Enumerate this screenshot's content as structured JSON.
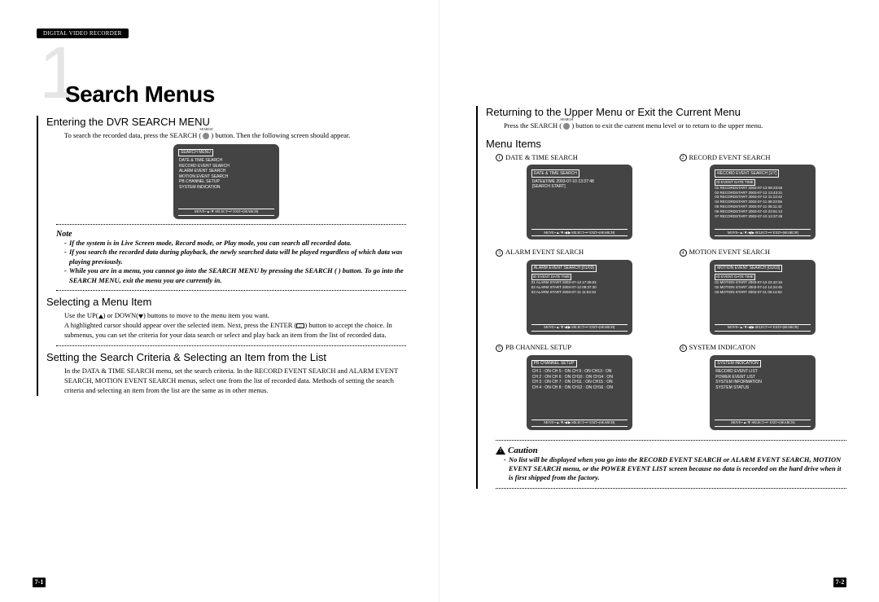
{
  "header_pill": "DIGITAL VIDEO RECORDER",
  "chapter_number": "1",
  "chapter_title": "Search Menus",
  "left": {
    "s1_title": "Entering the DVR SEARCH MENU",
    "s1_body_a": "To search the recorded data, press the SEARCH (",
    "s1_body_b": ") button. Then the following screen should appear.",
    "monitor1": {
      "title": "SEARCH MENU",
      "items": [
        "DATE & TIME SEARCH",
        "RECORD EVENT SEARCH",
        "ALARM EVENT SEARCH",
        "MOTION EVENT SEARCH",
        "PB CHANNEL SETUP",
        "SYSTEM INDICATION"
      ],
      "footer": "MOVE=▲/▼ SELECT=↵ EXIT=[SEARCH]"
    },
    "note_label": "Note",
    "note_items": [
      "If the system is in Live Screen mode, Record mode, or Play mode, you can search all recorded data.",
      "If you search the recorded data during playback, the newly searched data will be played regardless of which data was playing previously.",
      "While you are in a menu, you cannot go into the SEARCH MENU by pressing the SEARCH (      ) button. To go into the SEARCH MENU, exit the menu you are currently in."
    ],
    "s2_title": "Selecting a Menu Item",
    "s2_body_a": "Use the UP(",
    "s2_body_b": ") or DOWN(",
    "s2_body_c": ") buttons to move to the menu item you want.",
    "s2_body_d": "A highlighted cursor should appear over the selected item. Next, press the ENTER (",
    "s2_body_e": ") button to accept the choice. In submenus, you can set the criteria for your data search or select and play back an item from the list of recorded data.",
    "s3_title": "Setting the Search Criteria & Selecting an Item from the List",
    "s3_body": "In the DATA & TIME SEARCH menu, set the search criteria. In the RECORD EVENT SEARCH and ALARM EVENT SEARCH, MOTION EVENT SEARCH menus, select one from the list of recorded data. Methods of setting the search criteria and selecting an item from the list are the same as in other menus.",
    "page_num": "7-1"
  },
  "right": {
    "s1_title": "Returning to the Upper Menu or Exit the Current Menu",
    "s1_body_a": "Press the SEARCH (",
    "s1_body_b": ") button to exit the current menu level or to return to the upper menu.",
    "s2_title": "Menu Items",
    "labels": [
      "DATE & TIME SEARCH",
      "RECORD EVENT SEARCH",
      "ALARM EVENT SEARCH",
      "MOTION EVENT SEARCH",
      "PB CHANNEL SETUP",
      "SYSTEM INDICATON"
    ],
    "m1": {
      "title": "DATE & TIME SEARCH",
      "line1": "DATE&TIME  2003-07-10  13:37:48",
      "line2": "[SEARCH START]",
      "footer": "MOVE=▲/▼/◀/▶ SELECT=↵ EXIT=[SEARCH]"
    },
    "m2": {
      "title": "RECORD EVENT SEARCH      [1/7]",
      "hdr": "ID   EVENT         DATE          TIME",
      "rows": [
        "01  RECORDSTART 2003-07-13 08:23:55",
        "02  RECORDSTART 2003-07-12 13:43:21",
        "03  RECORDSTART 2003-07-12 11:13:42",
        "04  RECORDSTART 2003-07-11 08:23:55",
        "05  RECORDSTART 2003-07-11 05:11:42",
        "06  RECORDSTART 2003-07-10 23:51:12",
        "07  RECORDSTART 2003-07-10 13:37:48"
      ],
      "footer": "MOVE=▲/▼/◀/▶ SELECT=↵ EXIT=[SEARCH]"
    },
    "m3": {
      "title": "ALARM EVENT SEARCH      [01/03]",
      "hdr": "ID   EVENT         DATE          TIME",
      "rows": [
        "01 ALARM START 2003-07-13 17:28:02",
        "02 ALARM START 2003-07-12 08:37:30",
        "03 ALARM START 2003-07-11 11:54:34"
      ],
      "footer": "MOVE=▲/▼/◀/▶ SELECT=↵ EXIT=[SEARCH]"
    },
    "m4": {
      "title": "MOTION EVENT SEARCH      [01/03]",
      "hdr": "ID   EVENT         DATE          TIME",
      "rows": [
        "01  MOTION START 2003-07-13 22:42:16",
        "02  MOTION START 2003-07-12 14:24:45",
        "03  MOTION START 2003-07-11 06:13:52"
      ],
      "footer": "MOVE=▲/▼/◀/▶ SELECT=↵ EXIT=[SEARCH]"
    },
    "m5": {
      "title": "PB CHANNEL SETUP",
      "rows": [
        "CH 1 : ON  CH 5 : ON  CH 9 : ON  CH13 : ON",
        "CH 2 : ON  CH 6 : ON  CH10 : ON  CH14 : ON",
        "CH 3 : ON  CH 7 : ON  CH11 : ON  CH15 : ON",
        "CH 4 : ON  CH 8 : ON  CH12 : ON  CH16 : ON"
      ],
      "footer": "MOVE=▲/▼/◀/▶ SELECT=↵ EXIT=[SEARCH]"
    },
    "m6": {
      "title": "SYSTEM INDICATION",
      "rows": [
        "RECORD EVENT LIST",
        "POWER EVENT LIST",
        "SYSTEM INFORMATION",
        "SYSTEM STATUS"
      ],
      "footer": "MOVE=▲/▼ SELECT=↵ EXIT=[SEARCH]"
    },
    "caution_label": "Caution",
    "caution_body": "No list will be displayed when you go into the RECORD EVENT SEARCH or ALARM EVENT SEARCH, MOTION EVENT SEARCH menu, or the POWER EVENT LIST screen because no data is recorded on the hard drive when it is first shipped from the factory.",
    "page_num": "7-2"
  }
}
